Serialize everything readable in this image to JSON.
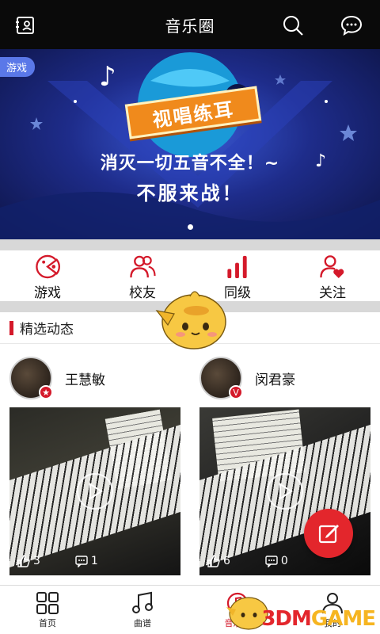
{
  "header": {
    "title": "音乐圈",
    "left_icon": "profile-card-icon",
    "search_icon": "search-icon",
    "message_icon": "chat-bubble-icon"
  },
  "banner": {
    "tag": "游戏",
    "ribbon_text": "视唱练耳",
    "slogan_line1": "消灭一切五音不全！~",
    "slogan_line2": "不服来战！",
    "page_count": 1,
    "active_page": 1
  },
  "quick_entries": [
    {
      "label": "游戏",
      "icon": "game-controller-icon"
    },
    {
      "label": "校友",
      "icon": "people-icon"
    },
    {
      "label": "同级",
      "icon": "level-bars-icon"
    },
    {
      "label": "关注",
      "icon": "follow-heart-icon"
    }
  ],
  "section": {
    "title": "精选动态"
  },
  "posts": [
    {
      "name": "王慧敏",
      "badge": "★",
      "likes": "3",
      "comments": "1"
    },
    {
      "name": "闵君豪",
      "badge": "V",
      "likes": "6",
      "comments": "0"
    }
  ],
  "bottom_nav": [
    {
      "label": "首页",
      "icon": "grid-icon",
      "active": false
    },
    {
      "label": "曲谱",
      "icon": "music-note-icon",
      "active": false
    },
    {
      "label": "音乐圈",
      "icon": "music-circle-icon",
      "active": true
    },
    {
      "label": "我的",
      "icon": "person-icon",
      "active": false
    }
  ],
  "watermark": {
    "part1": "3DM",
    "part2": "GAME"
  },
  "colors": {
    "accent": "#d4192a",
    "fab": "#e3262c",
    "topbar": "#0a0a0a",
    "banner": "#1e2c8a"
  }
}
